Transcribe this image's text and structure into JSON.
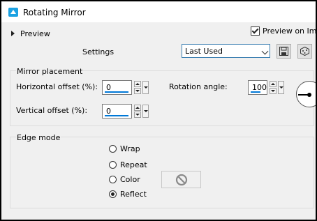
{
  "window": {
    "title": "Rotating Mirror",
    "icon": "app-icon"
  },
  "preview": {
    "toggle_label": "Preview",
    "on_image_label": "Preview on Ima",
    "on_image_checked": true
  },
  "settings": {
    "label": "Settings",
    "preset_value": "Last Used",
    "save_icon": "save-icon",
    "random_icon": "randomize-icon"
  },
  "mirror": {
    "group_title": "Mirror placement",
    "h_offset_label": "Horizontal offset (%):",
    "h_offset_value": "0",
    "v_offset_label": "Vertical offset (%):",
    "v_offset_value": "0",
    "rotation_label": "Rotation angle:",
    "rotation_value": "100"
  },
  "edge": {
    "group_title": "Edge mode",
    "options": [
      "Wrap",
      "Repeat",
      "Color",
      "Reflect"
    ],
    "selected": "Reflect",
    "color_icon": "no-color-icon"
  },
  "colors": {
    "accent": "#0078d7",
    "titlebar_icon": "#1ba1e2"
  }
}
